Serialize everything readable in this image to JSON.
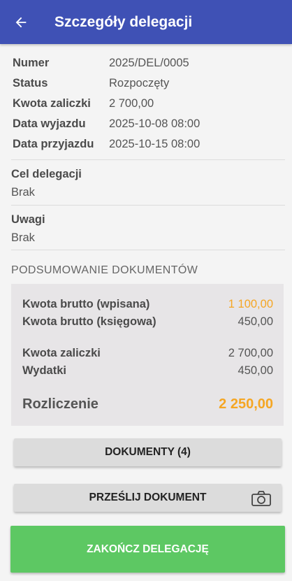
{
  "header": {
    "title": "Szczegóły delegacji",
    "back_icon": "arrow-left-icon",
    "bg_color": "#3f51b5"
  },
  "details": [
    {
      "label": "Numer",
      "value": "2025/DEL/0005"
    },
    {
      "label": "Status",
      "value": "Rozpoczęty"
    },
    {
      "label": "Kwota zaliczki",
      "value": "2 700,00"
    },
    {
      "label": "Data wyjazdu",
      "value": "2025-10-08 08:00"
    },
    {
      "label": "Data przyjazdu",
      "value": "2025-10-15 08:00"
    }
  ],
  "purpose": {
    "label": "Cel delegacji",
    "value": "Brak"
  },
  "notes": {
    "label": "Uwagi",
    "value": "Brak"
  },
  "summary": {
    "title": "PODSUMOWANIE DOKUMENTÓW",
    "gross_entered": {
      "label": "Kwota brutto (wpisana)",
      "value": "1 100,00"
    },
    "gross_booked": {
      "label": "Kwota brutto (księgowa)",
      "value": "450,00"
    },
    "advance": {
      "label": "Kwota zaliczki",
      "value": "2 700,00"
    },
    "expenses": {
      "label": "Wydatki",
      "value": "450,00"
    },
    "settlement": {
      "label": "Rozliczenie",
      "value": "2 250,00"
    },
    "accent_color": "#f5a623"
  },
  "buttons": {
    "documents": "DOKUMENTY (4)",
    "send_document": "PRZEŚLIJ DOKUMENT",
    "send_icon": "camera-icon",
    "finish": "ZAKOŃCZ DELEGACJĘ",
    "finish_color": "#5dc863"
  }
}
